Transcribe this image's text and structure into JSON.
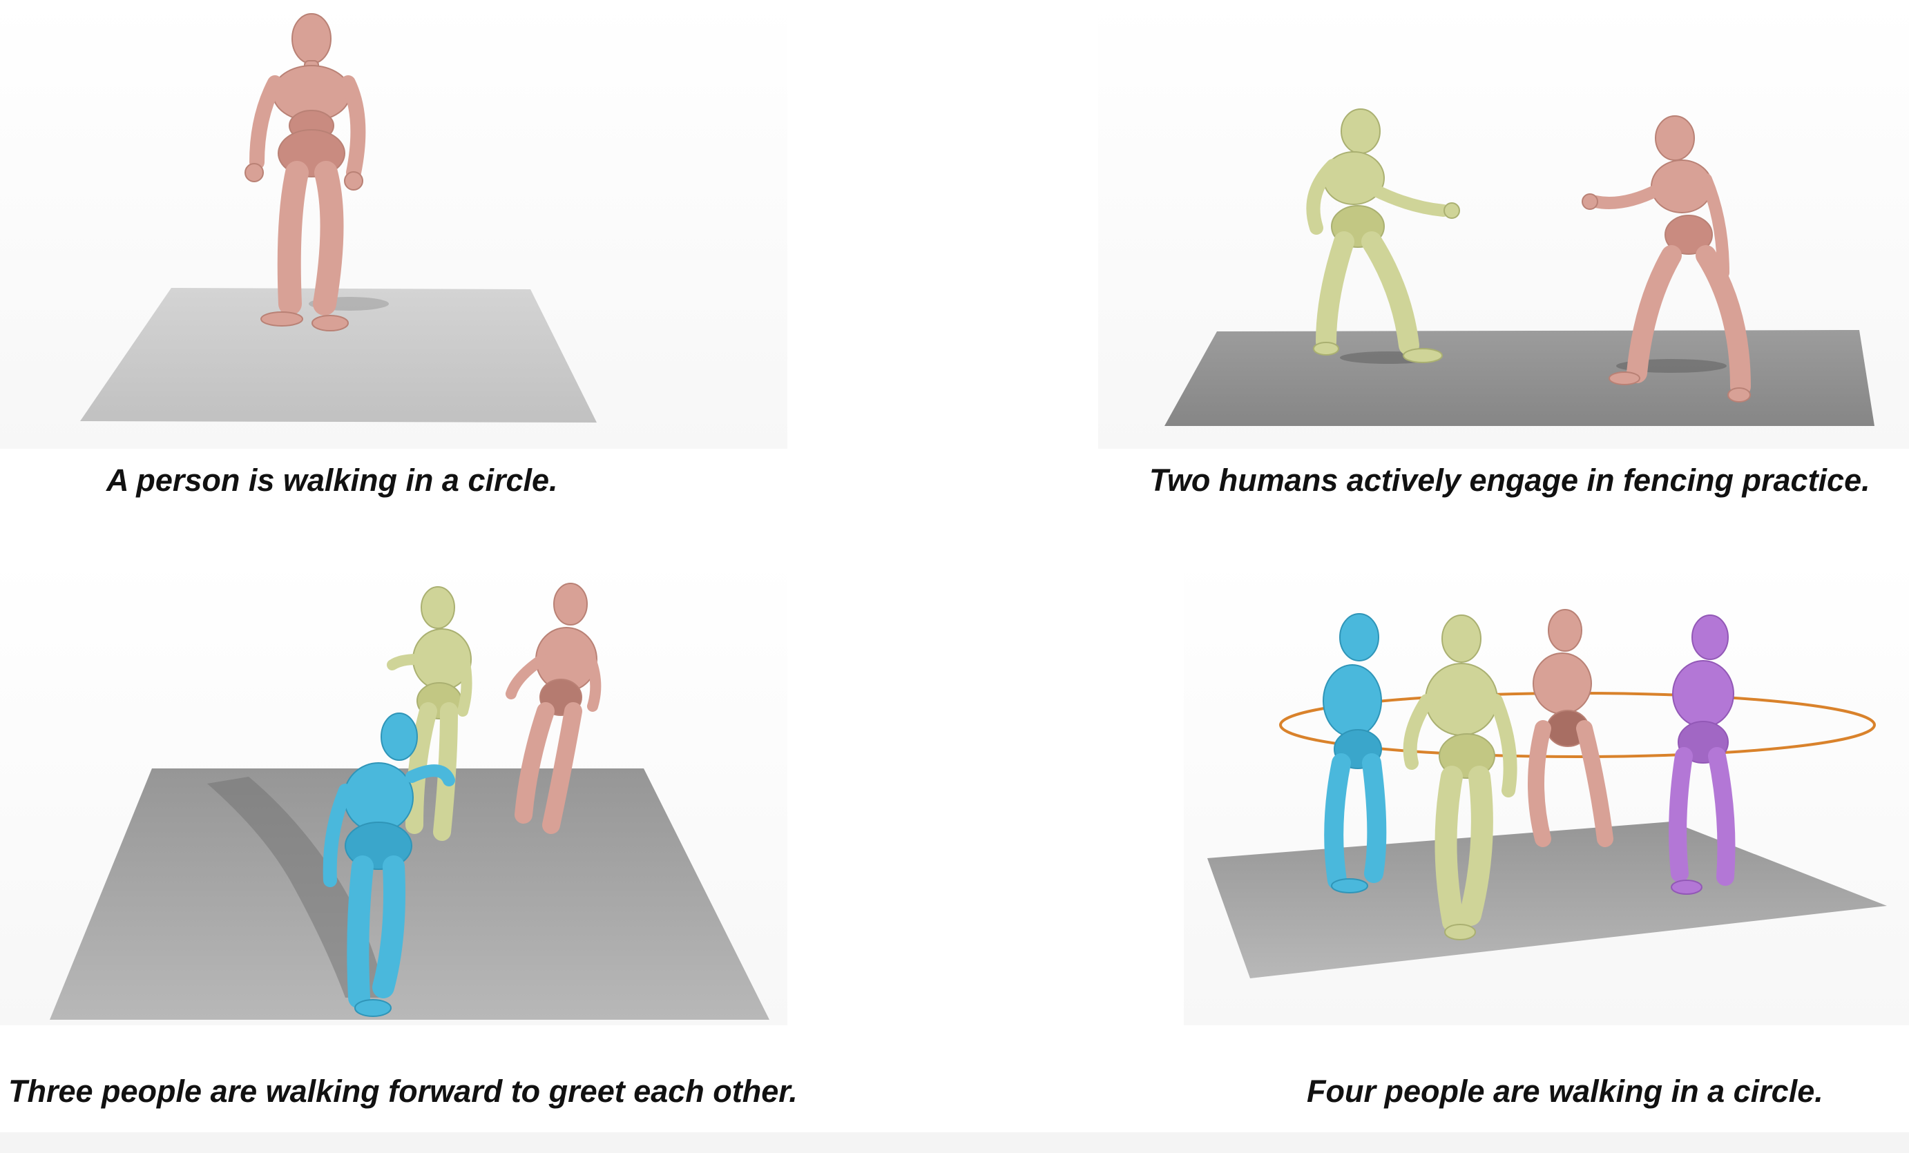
{
  "panels": [
    {
      "caption": "A person is walking in a circle."
    },
    {
      "caption": "Two humans actively engage in fencing practice."
    },
    {
      "caption": "Three people are walking forward to greet each other."
    },
    {
      "caption": "Four people are walking in a circle."
    }
  ],
  "colors": {
    "pink_figure": "#d8a196",
    "yellow_figure": "#cfd498",
    "blue_figure": "#4ab8dc",
    "purple_figure": "#b377d6",
    "ring": "#d9822b",
    "floor_light": "#c7c7c7",
    "floor_dark": "#8e8e8e"
  }
}
